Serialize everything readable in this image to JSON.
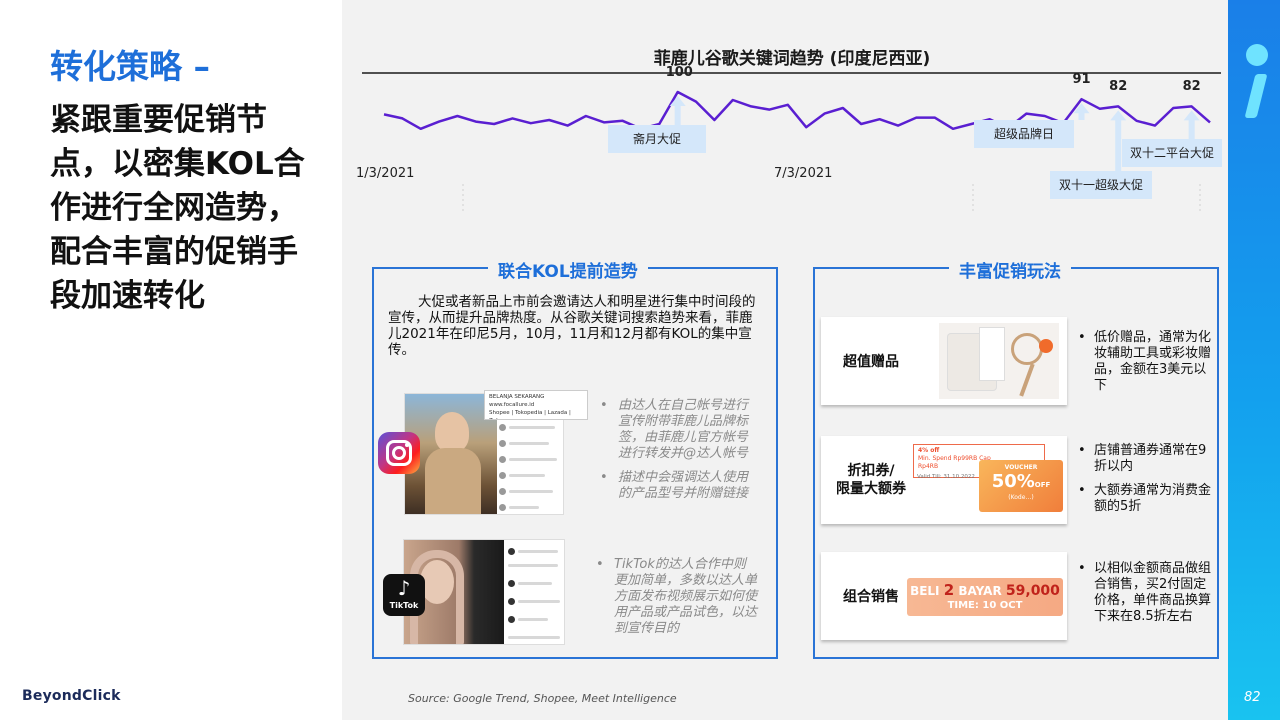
{
  "slide": {
    "kicker": "转化策略 –",
    "headline": "紧跟重要促销节点，以密集KOL合作进行全网造势，配合丰富的促销手段加速转化",
    "logo": "BeyondClick",
    "page_number": "82",
    "source": "Source: Google Trend, Shopee, Meet Intelligence"
  },
  "chart_data": {
    "type": "line",
    "title": "菲鹿儿谷歌关键词趋势 (印度尼西亚)",
    "x_tick_labels": [
      "1/3/2021",
      "7/3/2021"
    ],
    "y_range": [
      0,
      100
    ],
    "series": [
      {
        "color": "#5a1fd1",
        "values": [
          72,
          67,
          54,
          63,
          70,
          63,
          60,
          67,
          61,
          65,
          58,
          70,
          62,
          64,
          54,
          60,
          100,
          88,
          65,
          90,
          82,
          78,
          84,
          56,
          73,
          80,
          60,
          66,
          58,
          68,
          68,
          54,
          60,
          66,
          55,
          73,
          70,
          61,
          91,
          79,
          82,
          64,
          58,
          80,
          82,
          62
        ]
      }
    ],
    "peak_labels": [
      {
        "index": 16,
        "text": "100"
      },
      {
        "index": 38,
        "text": "91"
      },
      {
        "index": 40,
        "text": "82"
      },
      {
        "index": 44,
        "text": "82"
      }
    ],
    "annotations": [
      {
        "index": 16,
        "text": "斋月大促"
      },
      {
        "index": 38,
        "text": "超级品牌日"
      },
      {
        "index": 40,
        "text": "双十一超级大促"
      },
      {
        "index": 44,
        "text": "双十二平台大促"
      }
    ]
  },
  "kol_box": {
    "title": "联合KOL提前造势",
    "paragraph": "大促或者新品上市前会邀请达人和明星进行集中时间段的宣传，从而提升品牌热度。从谷歌关键词搜索趋势来看，菲鹿儿2021年在印尼5月，10月，11月和12月都有KOL的集中宣传。",
    "instagram_card": {
      "header": "BELANJA SEKARANG",
      "link": "www.focallure.id",
      "stores": "Shopee | Tokopedia | Lazada | Zalora"
    },
    "instagram_points": [
      "由达人在自己帐号进行宣传附带菲鹿儿品牌标签，由菲鹿儿官方帐号进行转发并@达人帐号",
      "描述中会强调达人使用的产品型号并附赠链接"
    ],
    "tiktok_label": "TikTok",
    "tiktok_points": [
      "TikTok的达人合作中则更加简单，多数以达人单方面发布视频展示如何使用产品或产品试色，以达到宣传目的"
    ]
  },
  "promo_box": {
    "title": "丰富促销玩法",
    "tiles": [
      {
        "label": "超值赠品",
        "notes": [
          "低价赠品，通常为化妆辅助工具或彩妆赠品，金额在3美元以下"
        ]
      },
      {
        "label_line1": "折扣券/",
        "label_line2": "限量大额券",
        "voucher": {
          "percent": "4% off",
          "min_spend": "Min. Spend Rp99RB Cap",
          "cap": "Rp4RB",
          "valid": "Valid Till: 31.10.2022",
          "badge": "VOUCHER",
          "big": "50%",
          "off": "OFF",
          "code": "(Kode…)"
        },
        "notes": [
          "店铺普通券通常在9折以内",
          "大额券通常为消费金额的5折"
        ]
      },
      {
        "label": "组合销售",
        "banner": {
          "line1_a": "BELI",
          "line1_b": "2",
          "line1_c": "BAYAR",
          "line1_d": "59,000",
          "line2": "TIME: 10 OCT"
        },
        "notes": [
          "以相似金额商品做组合销售，买2付固定价格，单件商品换算下来在8.5折左右"
        ]
      }
    ]
  }
}
